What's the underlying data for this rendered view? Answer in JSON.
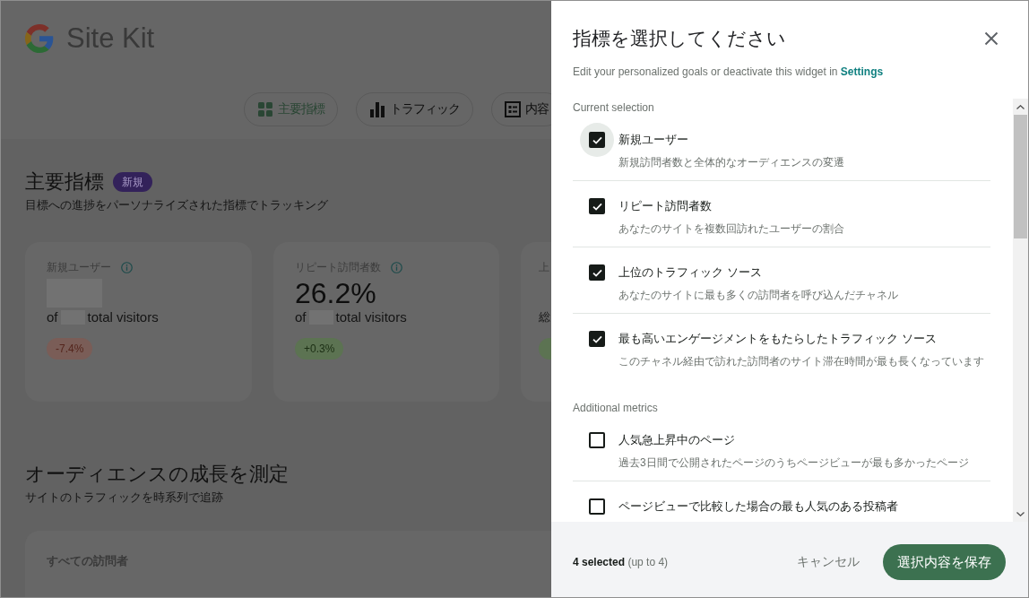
{
  "header": {
    "logo_text": "Site Kit",
    "tabs": [
      {
        "label": "主要指標",
        "selected": true
      },
      {
        "label": "トラフィック",
        "selected": false
      },
      {
        "label": "内容",
        "selected": false
      }
    ]
  },
  "key_metrics": {
    "title": "主要指標",
    "badge": "新規",
    "subtitle": "目標への進捗をパーソナライズされた指標でトラッキング",
    "cards": [
      {
        "kind": "metric",
        "title": "新規ユーザー",
        "note_before": "of",
        "note_after": "total visitors",
        "change": "-7.4%",
        "decrease": true
      },
      {
        "kind": "metric",
        "title": "リピート訪問者数",
        "value": "26.2%",
        "note_before": "of",
        "note_after": "total visitors",
        "change": "+0.3%",
        "decrease": false
      },
      {
        "kind": "partial",
        "title": "上",
        "note_before": "総",
        "decrease": false
      }
    ]
  },
  "audience": {
    "title": "オーディエンスの成長を測定",
    "subtitle": "サイトのトラフィックを時系列で追跡",
    "card_title": "すべての訪問者"
  },
  "panel": {
    "title": "指標を選択してください",
    "description": "Edit your personalized goals or deactivate this widget in",
    "link": "Settings",
    "sections": [
      {
        "heading": "Current selection",
        "items": [
          {
            "label": "新規ユーザー",
            "description": "新規訪問者数と全体的なオーディエンスの変遷",
            "checked": true,
            "focused": true
          },
          {
            "label": "リピート訪問者数",
            "description": "あなたのサイトを複数回訪れたユーザーの割合",
            "checked": true,
            "focused": false
          },
          {
            "label": "上位のトラフィック ソース",
            "description": "あなたのサイトに最も多くの訪問者を呼び込んだチャネル",
            "checked": true,
            "focused": false
          },
          {
            "label": "最も高いエンゲージメントをもたらしたトラフィック ソース",
            "description": "このチャネル経由で訪れた訪問者のサイト滞在時間が最も長くなっています",
            "checked": true,
            "focused": false
          }
        ]
      },
      {
        "heading": "Additional metrics",
        "items": [
          {
            "label": "人気急上昇中のページ",
            "description": "過去3日間で公開されたページのうちページビューが最も多かったページ",
            "checked": false,
            "focused": false
          },
          {
            "label": "ページビューで比較した場合の最も人気のある投稿者",
            "checked": false,
            "focused": false
          }
        ]
      }
    ]
  },
  "footer": {
    "selection": "**4 selected** (up to 4)",
    "cancel": "キャンセル",
    "save": "選択内容を保存"
  }
}
